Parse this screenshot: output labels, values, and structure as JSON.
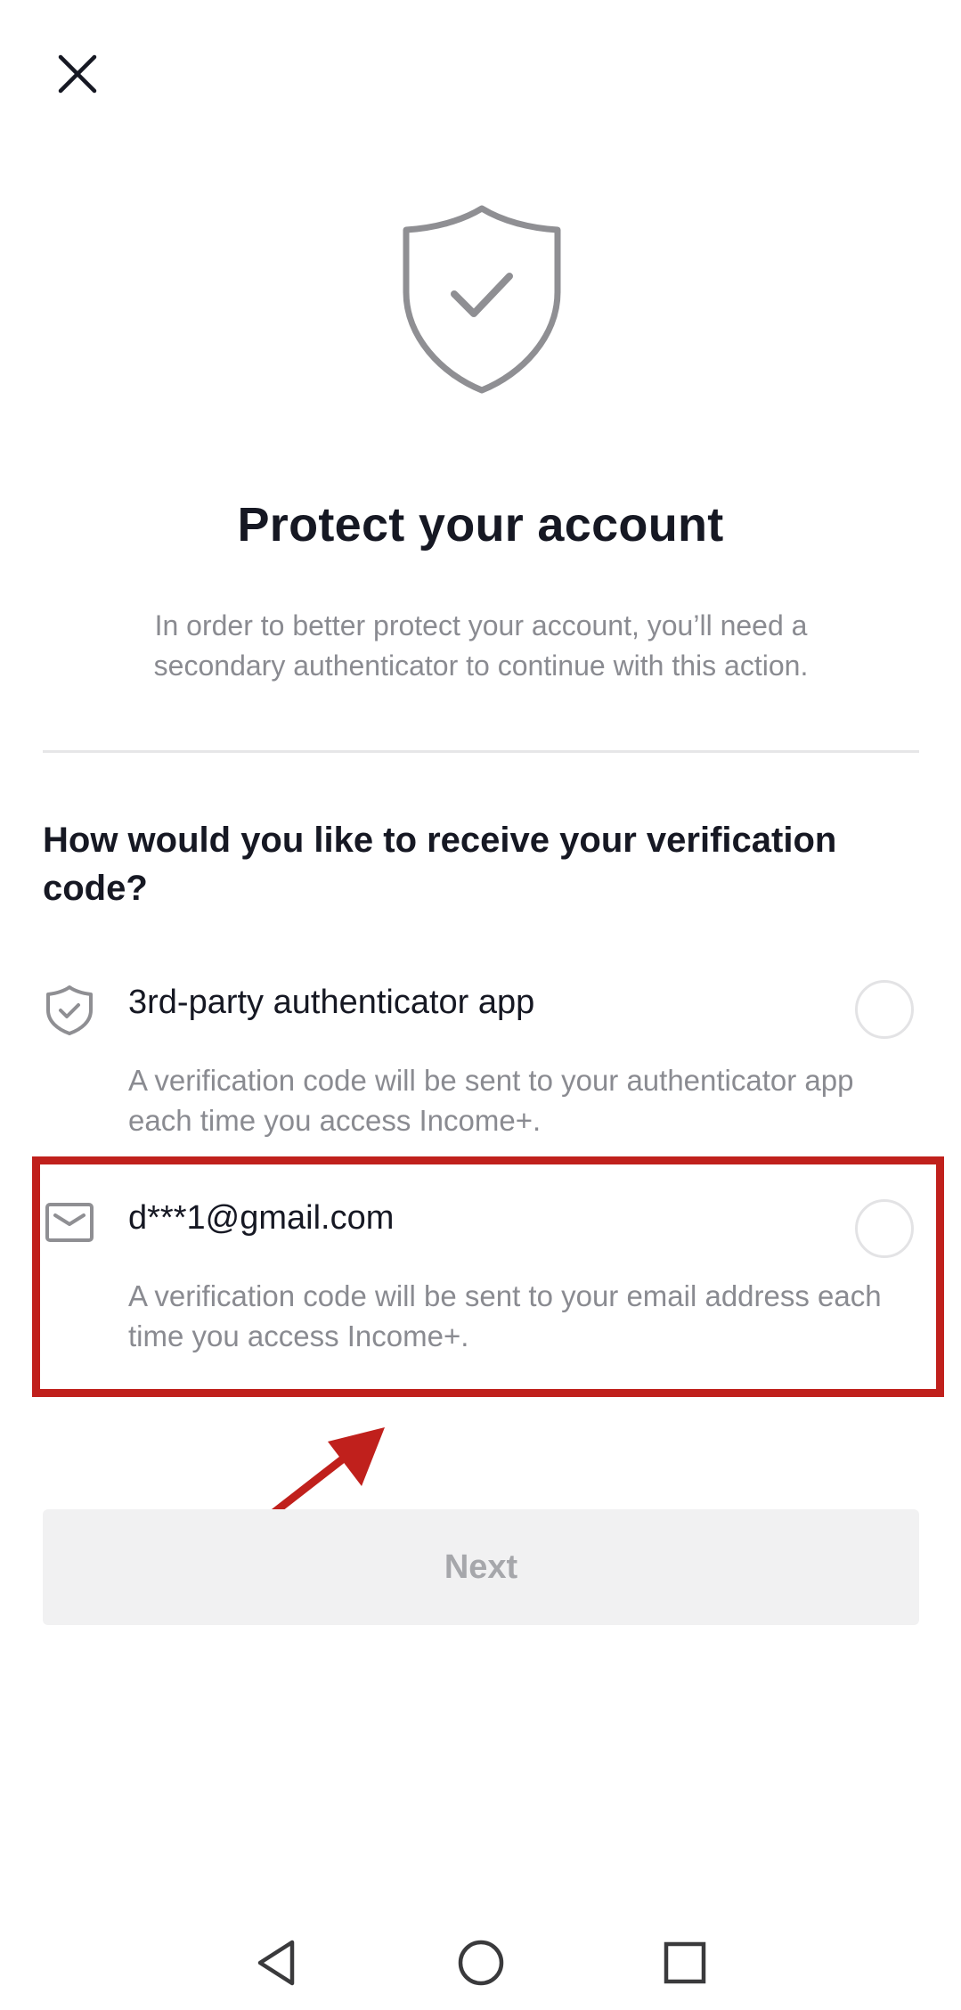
{
  "header": {
    "close_icon": "close-icon"
  },
  "hero": {
    "icon": "shield-check-icon",
    "title": "Protect your account",
    "subtitle": "In order to better protect your account, you’ll need a secondary authenticator to continue with this action."
  },
  "question": "How would you like to receive your verification code?",
  "options": [
    {
      "icon": "shield-check-icon",
      "label": "3rd-party authenticator app",
      "description": "A verification code will be sent to your authenticator app each time you access Income+.",
      "selected": false
    },
    {
      "icon": "mail-icon",
      "label": "d***1@gmail.com",
      "description": "A verification code will be sent to your email address each time you access Income+.",
      "selected": false
    }
  ],
  "next_button": {
    "label": "Next",
    "enabled": false
  },
  "annotation": {
    "highlight_color": "#c0201c"
  },
  "navbar": {
    "back_icon": "back-triangle-icon",
    "home_icon": "home-circle-icon",
    "recents_icon": "recents-square-icon"
  },
  "colors": {
    "text_primary": "#161823",
    "text_secondary": "#8a8b91",
    "icon_gray": "#8f8f93",
    "button_disabled_bg": "#f1f1f2",
    "button_disabled_text": "#a6a7ab"
  }
}
